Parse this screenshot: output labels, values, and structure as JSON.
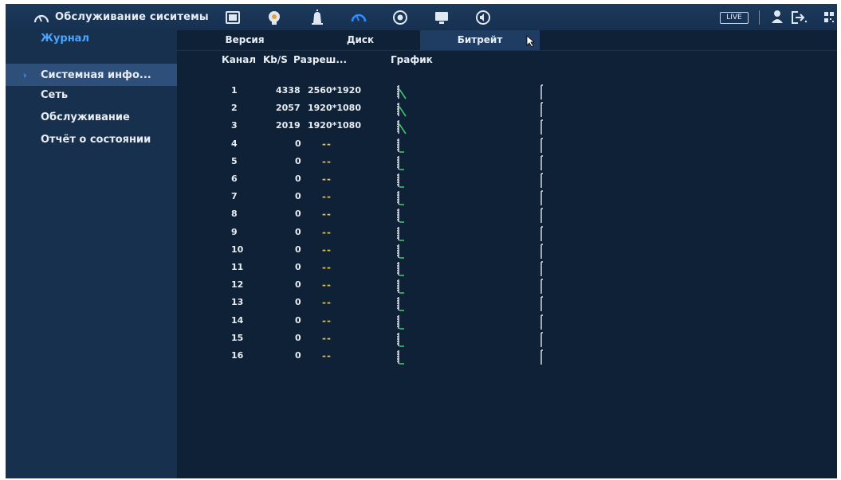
{
  "header": {
    "title": "Обслуживание сиситемы",
    "live_label": "LIVE",
    "icons": [
      "gauge-icon",
      "film-icon",
      "face-icon",
      "alarm-icon",
      "gauge-icon",
      "record-icon",
      "monitor-icon",
      "speaker-icon",
      "user-icon",
      "logout-icon",
      "qr-icon"
    ]
  },
  "sidebar": {
    "items": [
      {
        "label": "Журнал"
      },
      {
        "label": "Системная инфо..."
      },
      {
        "label": "Сеть"
      },
      {
        "label": "Обслуживание"
      },
      {
        "label": "Отчёт о состоянии"
      }
    ]
  },
  "tabs": [
    {
      "label": "Версия"
    },
    {
      "label": "Диск"
    },
    {
      "label": "Битрейт"
    }
  ],
  "table": {
    "headers": {
      "channel": "Канал",
      "kbs": "Kb/S",
      "resolution": "Разреш...",
      "graph": "График"
    },
    "rows": [
      {
        "channel": "1",
        "kbs": "4338",
        "resolution": "2560*1920"
      },
      {
        "channel": "2",
        "kbs": "2057",
        "resolution": "1920*1080"
      },
      {
        "channel": "3",
        "kbs": "2019",
        "resolution": "1920*1080"
      },
      {
        "channel": "4",
        "kbs": "0",
        "resolution": "--"
      },
      {
        "channel": "5",
        "kbs": "0",
        "resolution": "--"
      },
      {
        "channel": "6",
        "kbs": "0",
        "resolution": "--"
      },
      {
        "channel": "7",
        "kbs": "0",
        "resolution": "--"
      },
      {
        "channel": "8",
        "kbs": "0",
        "resolution": "--"
      },
      {
        "channel": "9",
        "kbs": "0",
        "resolution": "--"
      },
      {
        "channel": "10",
        "kbs": "0",
        "resolution": "--"
      },
      {
        "channel": "11",
        "kbs": "0",
        "resolution": "--"
      },
      {
        "channel": "12",
        "kbs": "0",
        "resolution": "--"
      },
      {
        "channel": "13",
        "kbs": "0",
        "resolution": "--"
      },
      {
        "channel": "14",
        "kbs": "0",
        "resolution": "--"
      },
      {
        "channel": "15",
        "kbs": "0",
        "resolution": "--"
      },
      {
        "channel": "16",
        "kbs": "0",
        "resolution": "--"
      }
    ]
  },
  "colors": {
    "background": "#102238",
    "sidebar": "#17304e",
    "accent": "#4aa3ff",
    "selected": "#2e4f7a",
    "dash": "#e8c23a",
    "graph": "#3fc46a"
  }
}
